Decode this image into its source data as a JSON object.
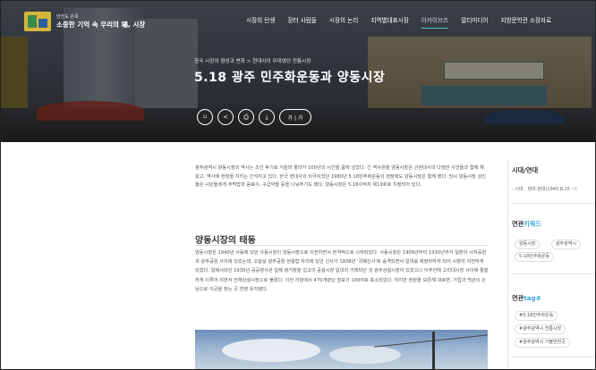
{
  "brand": {
    "subtitle": "안전도 손목",
    "title": "소중한 기억 속 우리의 場, 시장"
  },
  "nav": {
    "items": [
      {
        "label": "시장의 탄생"
      },
      {
        "label": "장터 사람들"
      },
      {
        "label": "시장의 논리"
      },
      {
        "label": "지역별대표시장"
      },
      {
        "label": "아카이브즈",
        "active": true
      },
      {
        "label": "멀티미디어"
      },
      {
        "label": "지방문학관 소장자료"
      }
    ]
  },
  "hero": {
    "breadcrumb": "한국 시장의 형성과 변화 > 현대사의 무대였던 전통시장",
    "title": "5.18 광주 민주화운동과 양동시장",
    "actions": [
      {
        "icon": "bookmark-icon",
        "glyph": "⌑"
      },
      {
        "icon": "share-icon",
        "glyph": "<"
      },
      {
        "icon": "print-icon",
        "glyph": "⎙"
      },
      {
        "icon": "download-icon",
        "glyph": "⤓"
      },
      {
        "icon": "font-size-icon",
        "glyph": "가 | 가"
      }
    ]
  },
  "content": {
    "intro": "광주광역시 양동시장의 역사는 조선 후기로 거슬러 올라가 100년의 시간을 품에 남았다. 긴 역사관을 양동시장은 근현대사의 다양한 사건들과 함께 해 왔고, 역사에 현장을 지키는 간석지고 있다. 한국 현대사의 비극이었던 1980년 5.18민주화운동의 현장에도 양동시장은 함께 했다. 당시 양동시장 상인들은 시민들에게 주먹밥과 음료수, 구급약을 등을 나눠주기도 했다. 양동시장은 5.18사적지 제19호로 지정되어 있다.",
    "section_title": "양동시장의 태동",
    "body": "양동시장은 1940년 사동에 있던 사동시장이 양동시장으로 이전하면서 본격적으로 시작되었다. 사동시장은 1909년부터 1930년까지 일본이 시작공원과 광주공원 사이에 있었는데, 오늘날 광주공원 현충탑 자리에 있던 신사가 1938년 '국폐신사'로 승격되면서 일대를 재정비하게 되어 시장이 이전하게 되었다. 일제시대인 1930년 공공영사관 일제 정거장을 입고의 공설시장 일대의 거래되던 것 광주상설시장이 있었으나 이주전해 고리대시장 사이에 활발하게 이루어 지면서 전체상설시장으로 불렸다. 이전 거창에서 470개였던 점포가 100여로 축소되었다. 하지만 현장을 보존해 대로변, 기업과 백관이 손님으로 이곳을 찾는 곳 연영 유지했다."
  },
  "sidebar": {
    "era_heading": "시대/연대",
    "era_value": "- 시대 : 현대·현대(1945.8.15 ~)",
    "keywords_heading_main": "연관",
    "keywords_heading_accent": "키워드",
    "keywords": [
      "양동시장",
      "광주광역시",
      "5.18민주화운동"
    ],
    "tags_heading_main": "연관",
    "tags_heading_accent": "tag",
    "tags_heading_hash": "#",
    "tags": [
      "#5.18민주화운동",
      "#광주광역시 전통시장",
      "#광주광역시 가볼만한곳"
    ]
  }
}
